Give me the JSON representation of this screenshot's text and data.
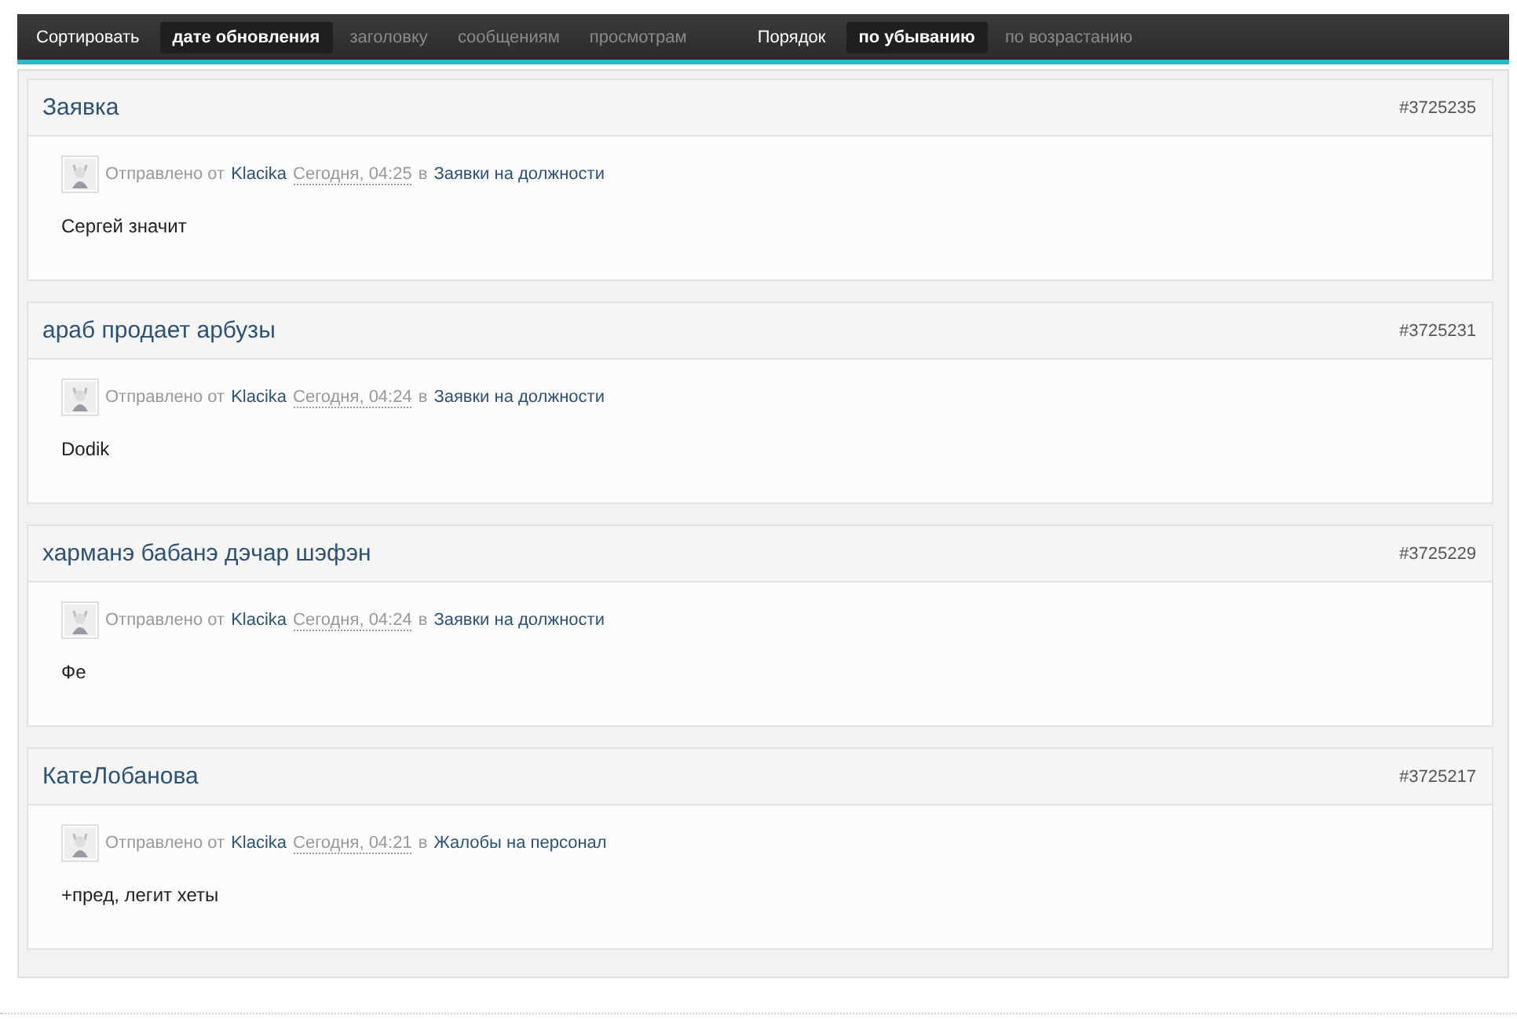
{
  "sort_bar": {
    "sort_label": "Сортировать",
    "sort_options": [
      {
        "label": "дате обновления",
        "selected": true
      },
      {
        "label": "заголовку",
        "selected": false
      },
      {
        "label": "сообщениям",
        "selected": false
      },
      {
        "label": "просмотрам",
        "selected": false
      }
    ],
    "order_label": "Порядок",
    "order_options": [
      {
        "label": "по убыванию",
        "selected": true
      },
      {
        "label": "по возрастанию",
        "selected": false
      }
    ]
  },
  "topics": [
    {
      "title": "Заявка",
      "id": "#3725235",
      "posted_by": "Отправлено от",
      "author": "Klacika",
      "date": "Сегодня, 04:25",
      "in": "в",
      "forum": "Заявки на должности",
      "text": "Сергей значит"
    },
    {
      "title": "араб продает арбузы",
      "id": "#3725231",
      "posted_by": "Отправлено от",
      "author": "Klacika",
      "date": "Сегодня, 04:24",
      "in": "в",
      "forum": "Заявки на должности",
      "text": "Dodik"
    },
    {
      "title": "харманэ бабанэ дэчар шэфэн",
      "id": "#3725229",
      "posted_by": "Отправлено от",
      "author": "Klacika",
      "date": "Сегодня, 04:24",
      "in": "в",
      "forum": "Заявки на должности",
      "text": "Фе"
    },
    {
      "title": "КатеЛобанова",
      "id": "#3725217",
      "posted_by": "Отправлено от",
      "author": "Klacika",
      "date": "Сегодня, 04:21",
      "in": "в",
      "forum": "Жалобы на персонал",
      "text": "+пред, легит хеты"
    }
  ]
}
